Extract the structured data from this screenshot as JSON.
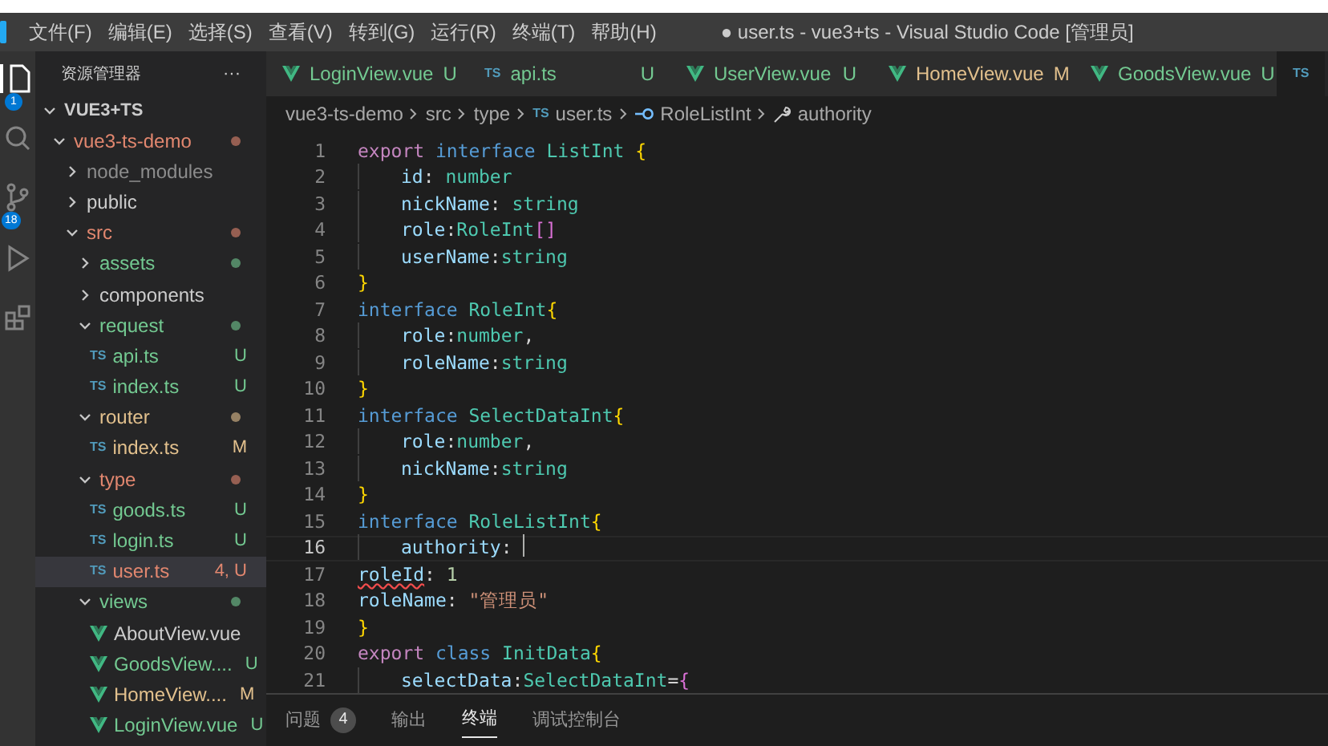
{
  "menu": [
    "文件(F)",
    "编辑(E)",
    "选择(S)",
    "查看(V)",
    "转到(G)",
    "运行(R)",
    "终端(T)",
    "帮助(H)"
  ],
  "window": {
    "title": "● user.ts - vue3+ts - Visual Studio Code [管理员]"
  },
  "activity_bar": [
    {
      "kind": "files",
      "badge": "1",
      "selected": true
    },
    {
      "kind": "search",
      "selected": false
    },
    {
      "kind": "scm",
      "badge": "18",
      "selected": false
    },
    {
      "kind": "run",
      "selected": false
    },
    {
      "kind": "extensions",
      "selected": false
    }
  ],
  "sidebar": {
    "title": "资源管理器",
    "more": "···",
    "section": "VUE3+TS",
    "items": [
      {
        "name": "vue3-ts-demo",
        "kind": "folder",
        "expanded": true,
        "color": "#e2876f",
        "dot": true,
        "selected": false,
        "children": [
          {
            "name": "node_modules",
            "kind": "folder",
            "expanded": false,
            "color": "#8c8c8c",
            "selected": false
          },
          {
            "name": "public",
            "kind": "folder",
            "expanded": false,
            "color": "#cccccc",
            "selected": false
          },
          {
            "name": "src",
            "kind": "folder",
            "expanded": true,
            "color": "#e2876f",
            "dot": true,
            "selected": false,
            "children": [
              {
                "name": "assets",
                "kind": "folder",
                "expanded": false,
                "color": "#73c991",
                "dot": true,
                "selected": false
              },
              {
                "name": "components",
                "kind": "folder",
                "expanded": false,
                "color": "#cccccc",
                "selected": false
              },
              {
                "name": "request",
                "kind": "folder",
                "expanded": true,
                "color": "#73c991",
                "dot": true,
                "selected": false,
                "children": [
                  {
                    "name": "api.ts",
                    "kind": "ts",
                    "type_label": "TS",
                    "badge": "U",
                    "color": "#73c991",
                    "selected": false
                  },
                  {
                    "name": "index.ts",
                    "kind": "ts",
                    "type_label": "TS",
                    "badge": "U",
                    "color": "#73c991",
                    "selected": false
                  }
                ]
              },
              {
                "name": "router",
                "kind": "folder",
                "expanded": true,
                "color": "#e2c08d",
                "dot": true,
                "selected": false,
                "children": [
                  {
                    "name": "index.ts",
                    "kind": "ts",
                    "type_label": "TS",
                    "badge": "M",
                    "color": "#e2c08d",
                    "selected": false
                  }
                ]
              },
              {
                "name": "type",
                "kind": "folder",
                "expanded": true,
                "color": "#e2876f",
                "dot": true,
                "selected": false,
                "children": [
                  {
                    "name": "goods.ts",
                    "kind": "ts",
                    "type_label": "TS",
                    "badge": "U",
                    "color": "#73c991",
                    "selected": false
                  },
                  {
                    "name": "login.ts",
                    "kind": "ts",
                    "type_label": "TS",
                    "badge": "U",
                    "color": "#73c991",
                    "selected": false
                  },
                  {
                    "name": "user.ts",
                    "kind": "ts",
                    "type_label": "TS",
                    "badge": "4, U",
                    "color": "#e2876f",
                    "selected": true
                  }
                ]
              },
              {
                "name": "views",
                "kind": "folder",
                "expanded": true,
                "color": "#73c991",
                "dot": true,
                "selected": false,
                "children": [
                  {
                    "name": "AboutView.vue",
                    "kind": "vue",
                    "color": "#cccccc",
                    "selected": false
                  },
                  {
                    "name": "GoodsView....",
                    "kind": "vue",
                    "badge": "U",
                    "color": "#73c991",
                    "selected": false
                  },
                  {
                    "name": "HomeView....",
                    "kind": "vue",
                    "badge": "M",
                    "color": "#e2c08d",
                    "selected": false
                  },
                  {
                    "name": "LoginView.vue",
                    "kind": "vue",
                    "badge": "U",
                    "color": "#73c991",
                    "selected": false
                  }
                ]
              }
            ]
          }
        ]
      }
    ]
  },
  "tabs": [
    {
      "kind": "vue",
      "label": "LoginView.vue",
      "status": "U",
      "color": "#73c991",
      "selected": false
    },
    {
      "kind": "ts",
      "type_label": "TS",
      "label": "api.ts",
      "status": "U",
      "color": "#73c991",
      "selected": false
    },
    {
      "kind": "vue",
      "label": "UserView.vue",
      "status": "U",
      "color": "#73c991",
      "selected": false
    },
    {
      "kind": "vue",
      "label": "HomeView.vue",
      "status": "M",
      "color": "#e2c08d",
      "selected": false
    },
    {
      "kind": "vue",
      "label": "GoodsView.vue",
      "status": "U",
      "color": "#73c991",
      "selected": false
    },
    {
      "kind": "ts",
      "type_label": "TS",
      "selected": true
    }
  ],
  "breadcrumb": [
    {
      "kind": "text",
      "label": "vue3-ts-demo"
    },
    {
      "kind": "text",
      "label": "src"
    },
    {
      "kind": "text",
      "label": "type"
    },
    {
      "kind": "ts",
      "type_label": "TS",
      "label": "user.ts"
    },
    {
      "kind": "interface",
      "label": "RoleListInt"
    },
    {
      "kind": "property",
      "label": "authority"
    }
  ],
  "editor": {
    "lines": [
      {
        "number": "1",
        "indented": false,
        "current": false,
        "tokens": [
          {
            "text": "export ",
            "kind": "keyword"
          },
          {
            "text": "interface ",
            "kind": "storage"
          },
          {
            "text": "ListInt ",
            "kind": "type"
          },
          {
            "text": "{",
            "kind": "bracket"
          }
        ]
      },
      {
        "number": "2",
        "indented": true,
        "current": false,
        "tokens": [
          {
            "text": "id",
            "kind": "prop"
          },
          {
            "text": ": ",
            "kind": "punct"
          },
          {
            "text": "number",
            "kind": "type"
          }
        ]
      },
      {
        "number": "3",
        "indented": true,
        "current": false,
        "tokens": [
          {
            "text": "nickName",
            "kind": "prop"
          },
          {
            "text": ": ",
            "kind": "punct"
          },
          {
            "text": "string",
            "kind": "type"
          }
        ]
      },
      {
        "number": "4",
        "indented": true,
        "current": false,
        "tokens": [
          {
            "text": "role",
            "kind": "prop"
          },
          {
            "text": ":",
            "kind": "punct"
          },
          {
            "text": "RoleInt",
            "kind": "type"
          },
          {
            "text": "[]",
            "kind": "bracket2"
          }
        ]
      },
      {
        "number": "5",
        "indented": true,
        "current": false,
        "tokens": [
          {
            "text": "userName",
            "kind": "prop"
          },
          {
            "text": ":",
            "kind": "punct"
          },
          {
            "text": "string",
            "kind": "type"
          }
        ]
      },
      {
        "number": "6",
        "indented": false,
        "current": false,
        "tokens": [
          {
            "text": "}",
            "kind": "bracket"
          }
        ]
      },
      {
        "number": "7",
        "indented": false,
        "current": false,
        "tokens": [
          {
            "text": "interface ",
            "kind": "storage"
          },
          {
            "text": "RoleInt",
            "kind": "type"
          },
          {
            "text": "{",
            "kind": "bracket"
          }
        ]
      },
      {
        "number": "8",
        "indented": true,
        "current": false,
        "tokens": [
          {
            "text": "role",
            "kind": "prop"
          },
          {
            "text": ":",
            "kind": "punct"
          },
          {
            "text": "number",
            "kind": "type"
          },
          {
            "text": ",",
            "kind": "punct"
          }
        ]
      },
      {
        "number": "9",
        "indented": true,
        "current": false,
        "tokens": [
          {
            "text": "roleName",
            "kind": "prop"
          },
          {
            "text": ":",
            "kind": "punct"
          },
          {
            "text": "string",
            "kind": "type"
          }
        ]
      },
      {
        "number": "10",
        "indented": false,
        "current": false,
        "tokens": [
          {
            "text": "}",
            "kind": "bracket"
          }
        ]
      },
      {
        "number": "11",
        "indented": false,
        "current": false,
        "tokens": [
          {
            "text": "interface ",
            "kind": "storage"
          },
          {
            "text": "SelectDataInt",
            "kind": "type"
          },
          {
            "text": "{",
            "kind": "bracket"
          }
        ]
      },
      {
        "number": "12",
        "indented": true,
        "current": false,
        "tokens": [
          {
            "text": "role",
            "kind": "prop"
          },
          {
            "text": ":",
            "kind": "punct"
          },
          {
            "text": "number",
            "kind": "type"
          },
          {
            "text": ",",
            "kind": "punct"
          }
        ]
      },
      {
        "number": "13",
        "indented": true,
        "current": false,
        "tokens": [
          {
            "text": "nickName",
            "kind": "prop"
          },
          {
            "text": ":",
            "kind": "punct"
          },
          {
            "text": "string",
            "kind": "type"
          }
        ]
      },
      {
        "number": "14",
        "indented": false,
        "current": false,
        "tokens": [
          {
            "text": "}",
            "kind": "bracket"
          }
        ]
      },
      {
        "number": "15",
        "indented": false,
        "current": false,
        "tokens": [
          {
            "text": "interface ",
            "kind": "storage"
          },
          {
            "text": "RoleListInt",
            "kind": "type"
          },
          {
            "text": "{",
            "kind": "bracket"
          }
        ]
      },
      {
        "number": "16",
        "indented": true,
        "current": true,
        "tokens": [
          {
            "text": "authority",
            "kind": "prop"
          },
          {
            "text": ": ",
            "kind": "punct"
          }
        ]
      },
      {
        "number": "17",
        "indented": false,
        "current": false,
        "tokens": [
          {
            "text": "roleId",
            "kind": "error"
          },
          {
            "text": ": ",
            "kind": "punct"
          },
          {
            "text": "1",
            "kind": "number"
          }
        ]
      },
      {
        "number": "18",
        "indented": false,
        "current": false,
        "tokens": [
          {
            "text": "roleName",
            "kind": "prop"
          },
          {
            "text": ": ",
            "kind": "punct"
          },
          {
            "text": "\"管理员\"",
            "kind": "string"
          }
        ]
      },
      {
        "number": "19",
        "indented": false,
        "current": false,
        "tokens": [
          {
            "text": "}",
            "kind": "bracket"
          }
        ]
      },
      {
        "number": "20",
        "indented": false,
        "current": false,
        "tokens": [
          {
            "text": "export ",
            "kind": "keyword"
          },
          {
            "text": "class ",
            "kind": "storage"
          },
          {
            "text": "InitData",
            "kind": "type"
          },
          {
            "text": "{",
            "kind": "bracket"
          }
        ]
      },
      {
        "number": "21",
        "indented": true,
        "current": false,
        "tokens": [
          {
            "text": "selectData",
            "kind": "prop"
          },
          {
            "text": ":",
            "kind": "punct"
          },
          {
            "text": "SelectDataInt",
            "kind": "type"
          },
          {
            "text": "=",
            "kind": "punct"
          },
          {
            "text": "{",
            "kind": "bracket2"
          }
        ]
      }
    ]
  },
  "panel": {
    "tabs": [
      {
        "label": "问题",
        "badge": "4",
        "selected": false
      },
      {
        "label": "输出",
        "selected": false
      },
      {
        "label": "终端",
        "selected": true
      },
      {
        "label": "调试控制台",
        "selected": false
      }
    ]
  }
}
